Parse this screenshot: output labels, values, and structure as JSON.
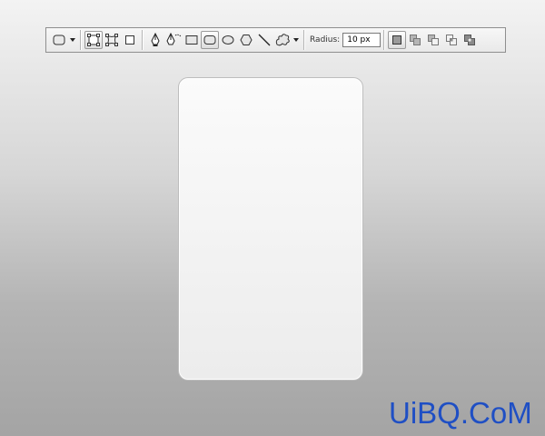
{
  "toolbar": {
    "tool_preset_icon": "rounded-rectangle-icon",
    "mode_buttons": [
      "shape-layers-icon",
      "paths-icon",
      "fill-pixels-icon"
    ],
    "shape_tools": [
      "pen-icon",
      "freeform-pen-icon",
      "rectangle-icon",
      "rounded-rectangle-icon",
      "ellipse-icon",
      "polygon-icon",
      "line-icon",
      "custom-shape-icon"
    ],
    "active_shape_tool": "rounded-rectangle-icon",
    "radius_label": "Radius:",
    "radius_value": "10 px",
    "combine_buttons": [
      "create-new-shape-icon",
      "add-to-shape-icon",
      "subtract-from-shape-icon",
      "intersect-shape-icon",
      "exclude-overlap-icon"
    ]
  },
  "canvas": {
    "shape": "rounded rectangle",
    "fill_top": "#fbfbfb",
    "fill_bottom": "#ececec"
  },
  "watermark": {
    "text": "UiBQ.CoM",
    "color": "#1f4fc4"
  }
}
